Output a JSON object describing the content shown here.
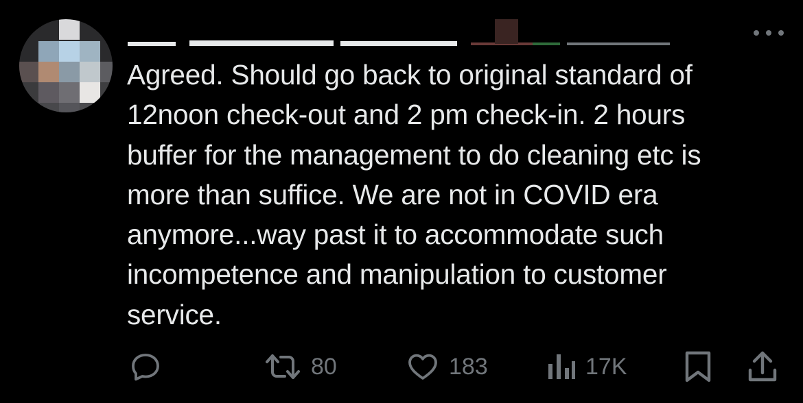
{
  "tweet": {
    "author": {
      "avatar": "avatar-pixelated",
      "name_redacted": true,
      "more_icon": "more-horizontal-icon"
    },
    "text": "Agreed. Should go back to original standard of\n12noon check-out and 2 pm check-in. 2 hours\nbuffer for the management to do cleaning etc is\nmore than suffice. We are not in COVID era\nanymore...way past it to accommodate such\nincompetence and manipulation to customer\nservice.",
    "actions": {
      "reply": {
        "icon": "reply-icon",
        "count": ""
      },
      "retweet": {
        "icon": "retweet-icon",
        "count": "80"
      },
      "like": {
        "icon": "heart-icon",
        "count": "183"
      },
      "views": {
        "icon": "views-icon",
        "count": "17K"
      },
      "bookmark": {
        "icon": "bookmark-icon"
      },
      "share": {
        "icon": "share-icon"
      }
    },
    "colors": {
      "background": "#000000",
      "text": "#e7e9ea",
      "muted": "#71767b"
    }
  }
}
